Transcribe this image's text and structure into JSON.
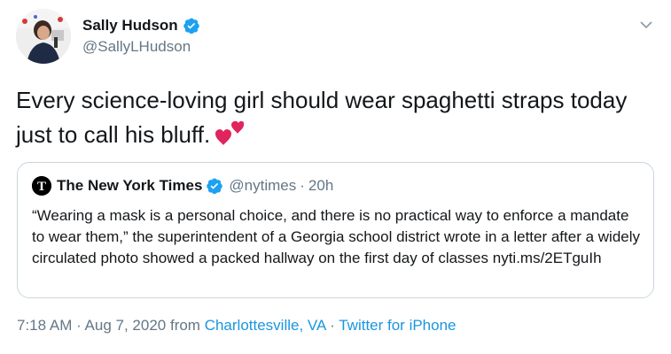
{
  "author": {
    "display_name": "Sally Hudson",
    "handle": "@SallyLHudson",
    "verified": true
  },
  "tweet": {
    "text": "Every science-loving girl should wear spaghetti straps today just to call his bluff.",
    "emoji": "two-hearts"
  },
  "quoted": {
    "display_name": "The New York Times",
    "handle": "@nytimes",
    "separator": "·",
    "time": "20h",
    "verified": true,
    "text": "“Wearing a mask is a personal choice, and there is no practical way to enforce a mandate to wear them,” the superintendent of a Georgia school district wrote in a letter after a widely circulated photo showed a packed hallway on the first day of classes nyti.ms/2ETguIh"
  },
  "meta": {
    "time": "7:18 AM",
    "sep1": " · ",
    "date": "Aug 7, 2020",
    "from": " from ",
    "location": "Charlottesville, VA",
    "sep2": " · ",
    "source": "Twitter for iPhone"
  },
  "colors": {
    "verified": "#1da1f2",
    "link": "#1b95e0",
    "secondary_text": "#657786",
    "border": "#ccd6dd",
    "heart": "#e0245e"
  }
}
